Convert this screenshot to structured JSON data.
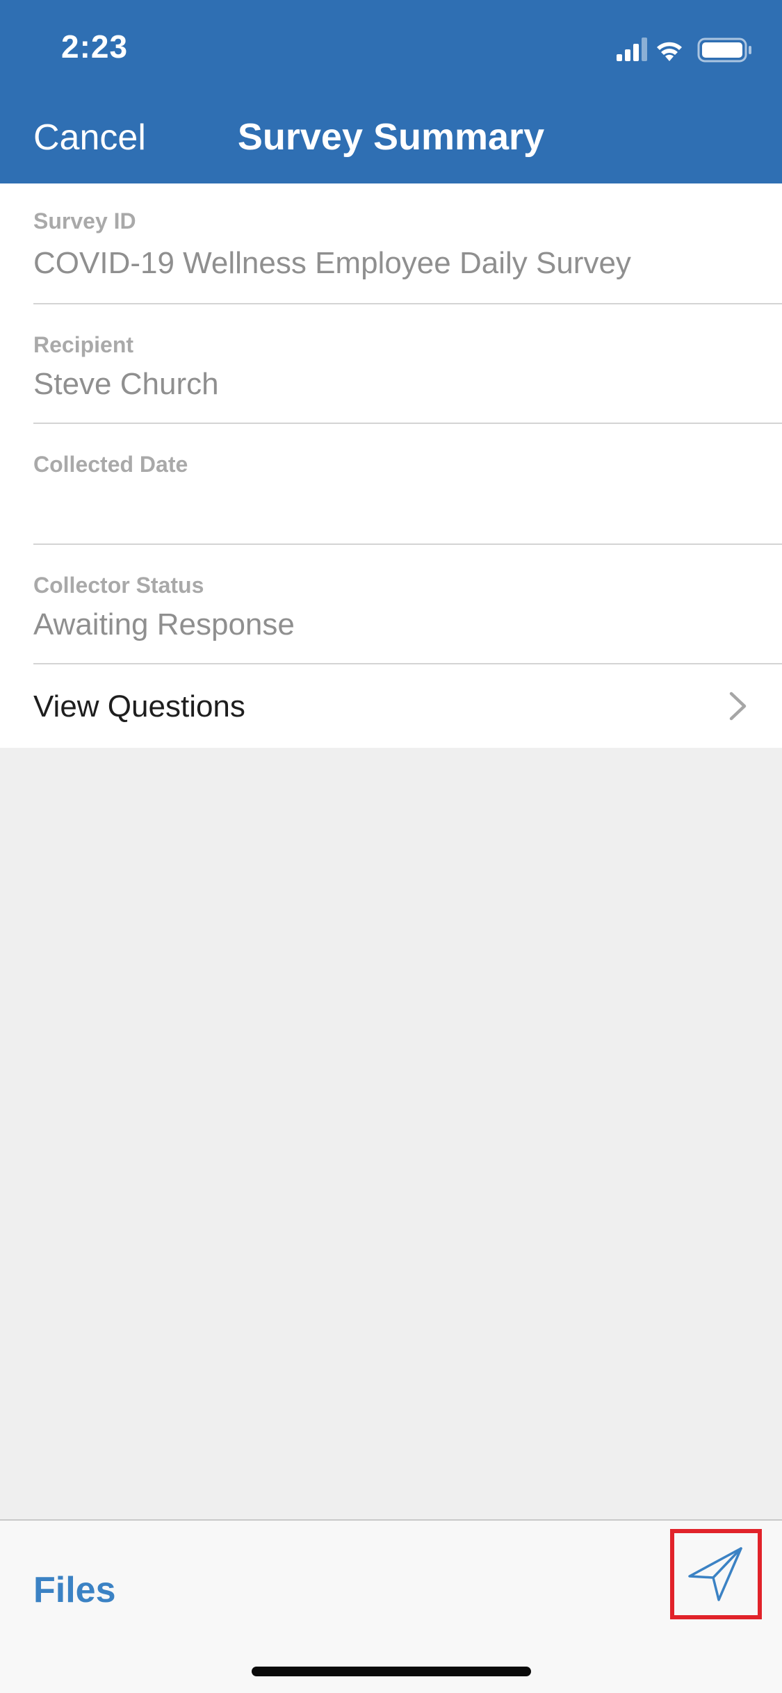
{
  "status_bar": {
    "time": "2:23"
  },
  "nav": {
    "cancel_label": "Cancel",
    "title": "Survey Summary"
  },
  "fields": [
    {
      "label": "Survey ID",
      "value": "COVID-19 Wellness Employee Daily Survey"
    },
    {
      "label": "Recipient",
      "value": "Steve Church"
    },
    {
      "label": "Collected Date",
      "value": ""
    },
    {
      "label": "Collector Status",
      "value": "Awaiting Response"
    }
  ],
  "view_questions": {
    "label": "View Questions",
    "icon": "chevron-right-icon"
  },
  "toolbar": {
    "files_label": "Files",
    "send_icon": "paper-plane-icon",
    "highlight_color": "#e1232a"
  },
  "colors": {
    "header_bg": "#2f6fb3",
    "accent": "#3b82c4",
    "background": "#efefef"
  }
}
